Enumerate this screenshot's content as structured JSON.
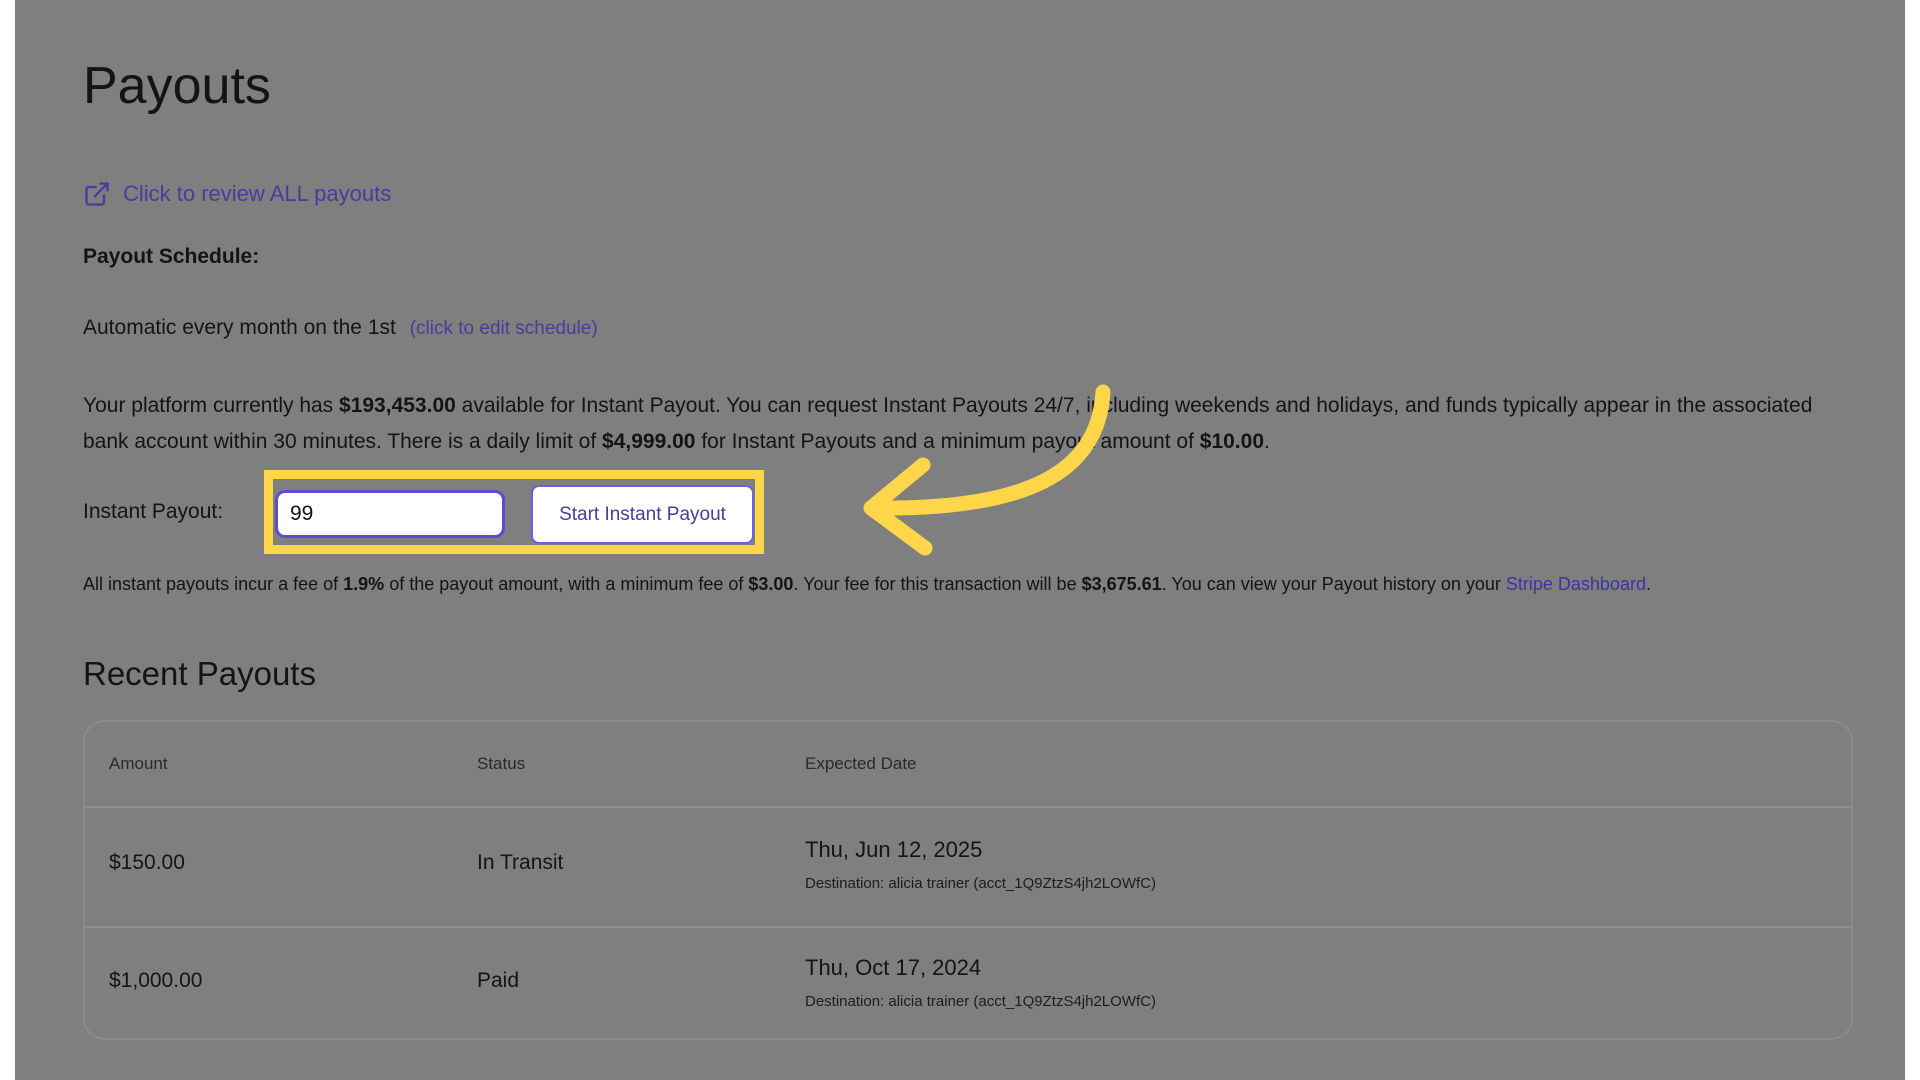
{
  "page": {
    "title": "Payouts",
    "review_link": "Click to review ALL payouts",
    "icons": {
      "review": "external-link-icon"
    }
  },
  "schedule": {
    "label": "Payout Schedule:",
    "text": "Automatic every month on the 1st",
    "edit_link": "(click to edit schedule)"
  },
  "description": {
    "part1": "Your platform currently has ",
    "available": "$193,453.00",
    "part2": " available for Instant Payout. You can request Instant Payouts 24/7, including weekends and holidays, and funds typically appear in the associated bank account within 30 minutes. There is a daily limit of ",
    "daily_limit": "$4,999.00",
    "part3": " for Instant Payouts and a minimum payout amount of ",
    "minimum": "$10.00",
    "part4": "."
  },
  "instant_payout": {
    "label": "Instant Payout:",
    "input_value": "99",
    "button_label": "Start Instant Payout"
  },
  "fee_note": {
    "part1": "All instant payouts incur a fee of ",
    "fee_pct": "1.9%",
    "part2": " of the payout amount, with a minimum fee of ",
    "min_fee": "$3.00",
    "part3": ". Your fee for this transaction will be ",
    "fee_amount": "$3,675.61",
    "part4": ". You can view your Payout history on your ",
    "dashboard_link": "Stripe Dashboard",
    "part5": "."
  },
  "recent": {
    "title": "Recent Payouts",
    "columns": [
      "Amount",
      "Status",
      "Expected Date"
    ],
    "rows": [
      {
        "amount": "$150.00",
        "status": "In Transit",
        "date": "Thu, Jun 12, 2025",
        "destination": "Destination: alicia trainer (acct_1Q9ZtzS4jh2LOWfC)"
      },
      {
        "amount": "$1,000.00",
        "status": "Paid",
        "date": "Thu, Oct 17, 2024",
        "destination": "Destination: alicia trainer (acct_1Q9ZtzS4jh2LOWfC)"
      }
    ]
  },
  "colors": {
    "overlay": "#7f7f7f",
    "highlight": "#ffd54a",
    "link": "#4a3c9a",
    "input_border": "#5b4bd6"
  }
}
